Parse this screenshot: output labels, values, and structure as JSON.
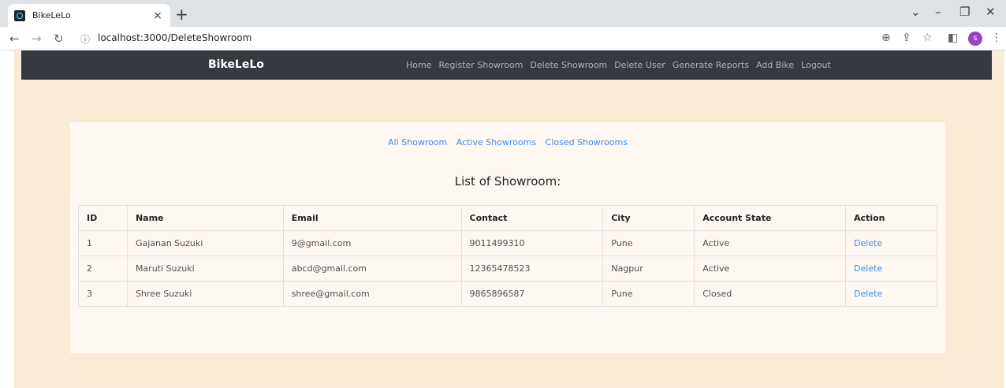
{
  "browser": {
    "tab_title": "BikeLeLo",
    "tab_close": "×",
    "new_tab": "+",
    "url": "localhost:3000/DeleteShowroom",
    "profile_initial": "s"
  },
  "nav": {
    "brand": "BikeLeLo",
    "links": [
      "Home",
      "Register Showroom",
      "Delete Showroom",
      "Delete User",
      "Generate Reports",
      "Add Bike",
      "Logout"
    ]
  },
  "filters": [
    "All Showroom",
    "Active Showrooms",
    "Closed Showrooms"
  ],
  "list_title": "List of Showroom:",
  "table": {
    "headers": [
      "ID",
      "Name",
      "Email",
      "Contact",
      "City",
      "Account State",
      "Action"
    ],
    "rows": [
      [
        "1",
        "Gajanan Suzuki",
        "9@gmail.com",
        "9011499310",
        "Pune",
        "Active",
        "Delete"
      ],
      [
        "2",
        "Maruti Suzuki",
        "abcd@gmail.com",
        "12365478523",
        "Nagpur",
        "Active",
        "Delete"
      ],
      [
        "3",
        "Shree Suzuki",
        "shree@gmail.com",
        "9865896587",
        "Pune",
        "Closed",
        "Delete"
      ]
    ]
  },
  "colors": {
    "navbar": "#343a40",
    "page_background": "#faebd7",
    "card_background": "#fff8f2",
    "link": "#3a8fe6"
  }
}
